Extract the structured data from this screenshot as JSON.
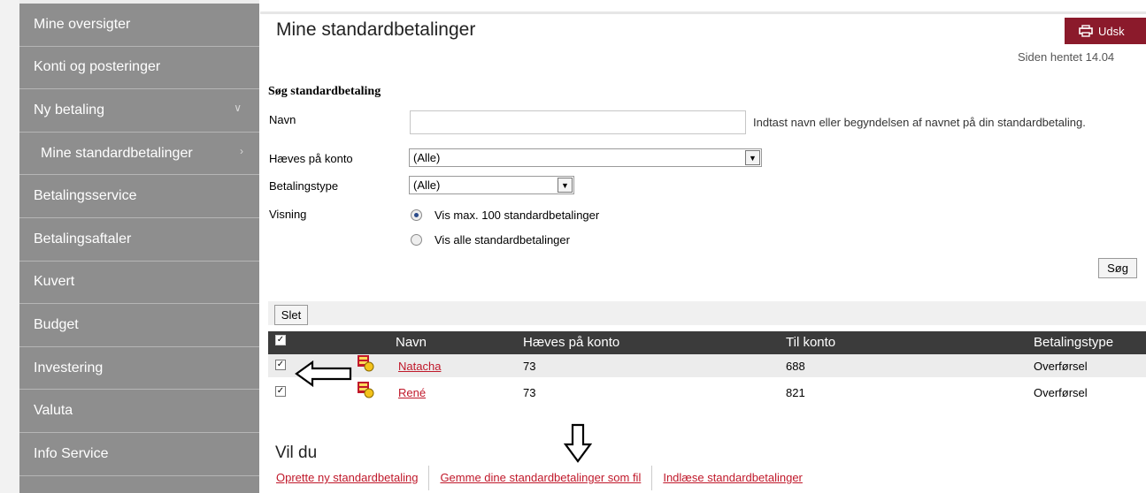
{
  "sidebar": {
    "items": [
      {
        "label": "Mine oversigter"
      },
      {
        "label": "Konti og posteringer"
      },
      {
        "label": "Ny betaling"
      },
      {
        "label": "Mine standardbetalinger"
      },
      {
        "label": "Betalingsservice"
      },
      {
        "label": "Betalingsaftaler"
      },
      {
        "label": "Kuvert"
      },
      {
        "label": "Budget"
      },
      {
        "label": "Investering"
      },
      {
        "label": "Valuta"
      },
      {
        "label": "Info Service"
      }
    ]
  },
  "header": {
    "title": "Mine standardbetalinger",
    "print_label": "Udsk",
    "fetched": "Siden hentet 14.04"
  },
  "search": {
    "title": "Søg standardbetaling",
    "name_label": "Navn",
    "name_value": "",
    "name_hint": "Indtast navn eller begyndelsen af navnet på din standardbetaling.",
    "account_label": "Hæves på konto",
    "account_value": "(Alle)",
    "type_label": "Betalingstype",
    "type_value": "(Alle)",
    "view_label": "Visning",
    "view_option_1": "Vis max. 100 standardbetalinger",
    "view_option_2": "Vis alle standardbetalinger",
    "search_button": "Søg"
  },
  "table": {
    "delete_button": "Slet",
    "columns": [
      "Navn",
      "Hæves på konto",
      "Til konto",
      "Betalingstype"
    ],
    "rows": [
      {
        "name": "Natacha",
        "from": "73",
        "to": "688",
        "type": "Overførsel",
        "checked": true
      },
      {
        "name": "René",
        "from": "73",
        "to": "821",
        "type": "Overførsel",
        "checked": true
      }
    ]
  },
  "footer": {
    "heading": "Vil du",
    "actions": [
      "Oprette ny standardbetaling",
      "Gemme dine standardbetalinger som fil",
      "Indlæse standardbetalinger"
    ]
  },
  "colors": {
    "sidebar": "#8e8e8e",
    "accent": "#8b1a2b",
    "link": "#c0182a",
    "grid_header": "#3b3b3b"
  }
}
